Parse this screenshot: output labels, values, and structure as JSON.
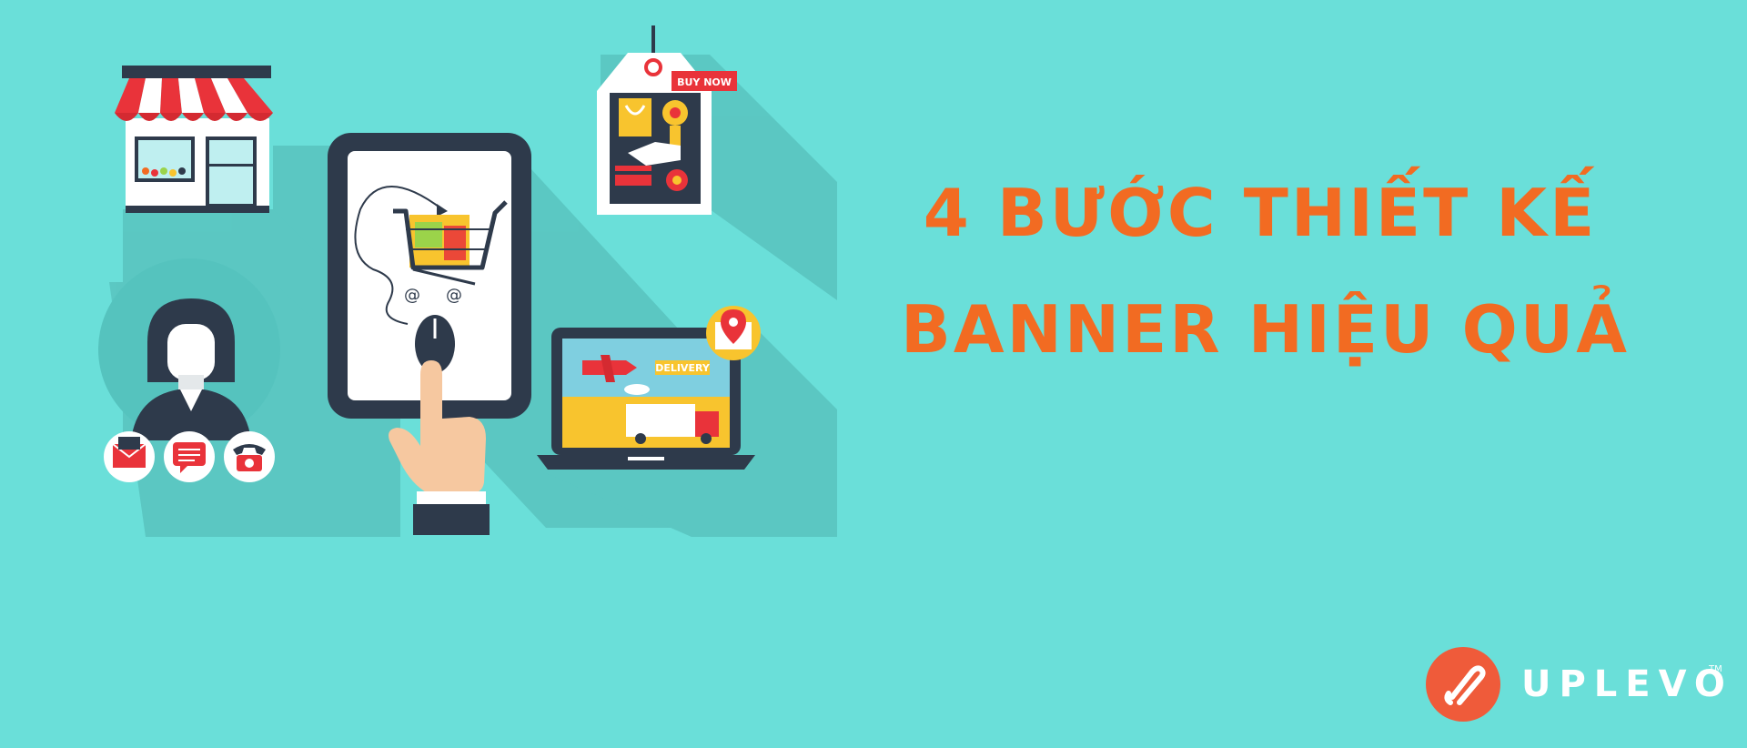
{
  "headline": {
    "line1": "4 BƯỚC THIẾT KẾ",
    "line2": "BANNER HIỆU QUẢ"
  },
  "illustration": {
    "tag_label": "BUY NOW",
    "laptop_label": "DELIVERY",
    "cart_at_1": "@",
    "cart_at_2": "@"
  },
  "logo": {
    "text": "UPLEVO",
    "tm": "TM"
  },
  "colors": {
    "background": "#6ADFD9",
    "accent": "#F26B22",
    "logo_circle": "#EF5B3A"
  }
}
